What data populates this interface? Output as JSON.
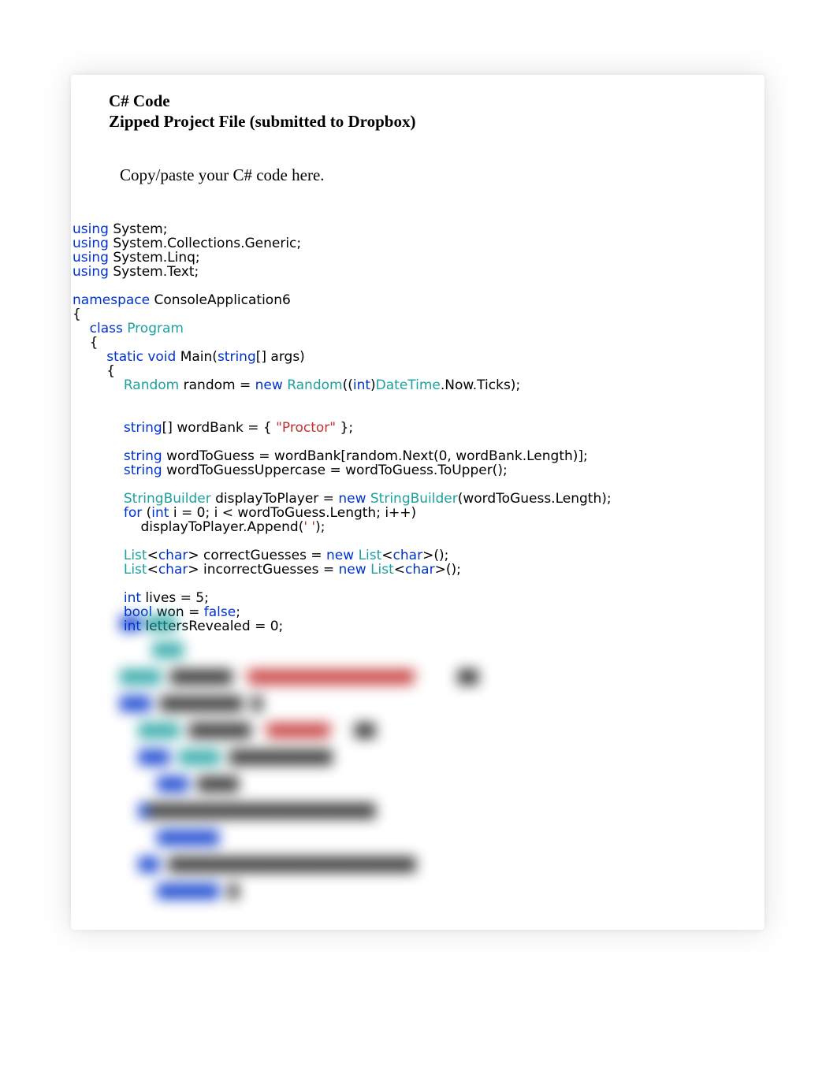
{
  "header": {
    "line1": "C# Code",
    "line2": "Zipped Project File (submitted to Dropbox)"
  },
  "instruction": "Copy/paste your C# code here.",
  "code": {
    "lines": [
      {
        "indent": 0,
        "tokens": [
          {
            "t": "using ",
            "c": "kw"
          },
          {
            "t": "System;",
            "c": "id"
          }
        ]
      },
      {
        "indent": 0,
        "tokens": [
          {
            "t": "using ",
            "c": "kw"
          },
          {
            "t": "System.Collections.Generic;",
            "c": "id"
          }
        ]
      },
      {
        "indent": 0,
        "tokens": [
          {
            "t": "using ",
            "c": "kw"
          },
          {
            "t": "System.Linq;",
            "c": "id"
          }
        ]
      },
      {
        "indent": 0,
        "tokens": [
          {
            "t": "using ",
            "c": "kw"
          },
          {
            "t": "System.Text;",
            "c": "id"
          }
        ]
      },
      {
        "indent": 0,
        "tokens": []
      },
      {
        "indent": 0,
        "tokens": [
          {
            "t": "namespace ",
            "c": "kw"
          },
          {
            "t": "ConsoleApplication6",
            "c": "id"
          }
        ]
      },
      {
        "indent": 0,
        "tokens": [
          {
            "t": "{",
            "c": "id"
          }
        ]
      },
      {
        "indent": 1,
        "tokens": [
          {
            "t": "class ",
            "c": "kw"
          },
          {
            "t": "Program",
            "c": "typ"
          }
        ]
      },
      {
        "indent": 1,
        "tokens": [
          {
            "t": "{",
            "c": "id"
          }
        ]
      },
      {
        "indent": 2,
        "tokens": [
          {
            "t": "static ",
            "c": "kw"
          },
          {
            "t": "void ",
            "c": "kw"
          },
          {
            "t": "Main(",
            "c": "id"
          },
          {
            "t": "string",
            "c": "kw"
          },
          {
            "t": "[] args)",
            "c": "id"
          }
        ]
      },
      {
        "indent": 2,
        "tokens": [
          {
            "t": "{",
            "c": "id"
          }
        ]
      },
      {
        "indent": 3,
        "tokens": [
          {
            "t": "Random",
            "c": "typ"
          },
          {
            "t": " random = ",
            "c": "id"
          },
          {
            "t": "new ",
            "c": "kw"
          },
          {
            "t": "Random",
            "c": "typ"
          },
          {
            "t": "((",
            "c": "id"
          },
          {
            "t": "int",
            "c": "kw"
          },
          {
            "t": ")",
            "c": "id"
          },
          {
            "t": "DateTime",
            "c": "typ"
          },
          {
            "t": ".Now.Ticks);",
            "c": "id"
          }
        ]
      },
      {
        "indent": 0,
        "tokens": []
      },
      {
        "indent": 0,
        "tokens": []
      },
      {
        "indent": 3,
        "tokens": [
          {
            "t": "string",
            "c": "kw"
          },
          {
            "t": "[] wordBank = { ",
            "c": "id"
          },
          {
            "t": "\"Proctor\"",
            "c": "str"
          },
          {
            "t": " };",
            "c": "id"
          }
        ]
      },
      {
        "indent": 0,
        "tokens": []
      },
      {
        "indent": 3,
        "tokens": [
          {
            "t": "string",
            "c": "kw"
          },
          {
            "t": " wordToGuess = wordBank[random.Next(0, wordBank.Length)];",
            "c": "id"
          }
        ]
      },
      {
        "indent": 3,
        "tokens": [
          {
            "t": "string",
            "c": "kw"
          },
          {
            "t": " wordToGuessUppercase = wordToGuess.ToUpper();",
            "c": "id"
          }
        ]
      },
      {
        "indent": 0,
        "tokens": []
      },
      {
        "indent": 3,
        "tokens": [
          {
            "t": "StringBuilder",
            "c": "typ"
          },
          {
            "t": " displayToPlayer = ",
            "c": "id"
          },
          {
            "t": "new ",
            "c": "kw"
          },
          {
            "t": "StringBuilder",
            "c": "typ"
          },
          {
            "t": "(wordToGuess.Length);",
            "c": "id"
          }
        ]
      },
      {
        "indent": 3,
        "tokens": [
          {
            "t": "for ",
            "c": "kw"
          },
          {
            "t": "(",
            "c": "id"
          },
          {
            "t": "int",
            "c": "kw"
          },
          {
            "t": " i = 0; i < wordToGuess.Length; i++)",
            "c": "id"
          }
        ]
      },
      {
        "indent": 4,
        "tokens": [
          {
            "t": "displayToPlayer.Append(",
            "c": "id"
          },
          {
            "t": "' '",
            "c": "str"
          },
          {
            "t": ");",
            "c": "id"
          }
        ]
      },
      {
        "indent": 0,
        "tokens": []
      },
      {
        "indent": 3,
        "tokens": [
          {
            "t": "List",
            "c": "typ"
          },
          {
            "t": "<",
            "c": "id"
          },
          {
            "t": "char",
            "c": "kw"
          },
          {
            "t": "> correctGuesses = ",
            "c": "id"
          },
          {
            "t": "new ",
            "c": "kw"
          },
          {
            "t": "List",
            "c": "typ"
          },
          {
            "t": "<",
            "c": "id"
          },
          {
            "t": "char",
            "c": "kw"
          },
          {
            "t": ">();",
            "c": "id"
          }
        ]
      },
      {
        "indent": 3,
        "tokens": [
          {
            "t": "List",
            "c": "typ"
          },
          {
            "t": "<",
            "c": "id"
          },
          {
            "t": "char",
            "c": "kw"
          },
          {
            "t": "> incorrectGuesses = ",
            "c": "id"
          },
          {
            "t": "new ",
            "c": "kw"
          },
          {
            "t": "List",
            "c": "typ"
          },
          {
            "t": "<",
            "c": "id"
          },
          {
            "t": "char",
            "c": "kw"
          },
          {
            "t": ">();",
            "c": "id"
          }
        ]
      },
      {
        "indent": 0,
        "tokens": []
      },
      {
        "indent": 3,
        "tokens": [
          {
            "t": "int",
            "c": "kw"
          },
          {
            "t": " lives = 5;",
            "c": "id"
          }
        ]
      },
      {
        "indent": 3,
        "tokens": [
          {
            "t": "bool",
            "c": "kw"
          },
          {
            "t": " won = ",
            "c": "id"
          },
          {
            "t": "false",
            "c": "kw"
          },
          {
            "t": ";",
            "c": "id"
          }
        ]
      },
      {
        "indent": 3,
        "tokens": [
          {
            "t": "int",
            "c": "kw"
          },
          {
            "t": " lettersRevealed = 0;",
            "c": "id"
          }
        ]
      }
    ]
  },
  "blurred": {
    "lines": [
      [
        {
          "t": "██ ",
          "c": "bb2"
        },
        {
          "t": "███",
          "c": "bb1"
        }
      ],
      [
        {
          "t": "       ███",
          "c": "bb1"
        }
      ],
      [
        {
          "t": "████",
          "c": "bb1"
        },
        {
          "t": "  ██████  ",
          "c": "bb4"
        },
        {
          "t": "\"████████████████\"",
          "c": "bb3"
        },
        {
          "t": "        ██",
          "c": "bb4"
        }
      ],
      [
        {
          "t": "███",
          "c": "bb2"
        },
        {
          "t": "  ████████  █",
          "c": "bb4"
        }
      ],
      [
        {
          "t": "    ████",
          "c": "bb1"
        },
        {
          "t": "  ██████  ",
          "c": "bb4"
        },
        {
          "t": "\"██████\"",
          "c": "bb3"
        },
        {
          "t": "    ██",
          "c": "bb4"
        }
      ],
      [
        {
          "t": "    ███",
          "c": "bb2"
        },
        {
          "t": "  ████",
          "c": "bb1"
        },
        {
          "t": "  ██████████",
          "c": "bb4"
        }
      ],
      [
        {
          "t": "        ███",
          "c": "bb2"
        },
        {
          "t": "  ████",
          "c": "bb4"
        }
      ],
      [
        {
          "t": "    █",
          "c": "bb2"
        },
        {
          "t": "██████████████████████",
          "c": "bb4"
        }
      ],
      [
        {
          "t": "        ██████",
          "c": "bb2"
        }
      ],
      [
        {
          "t": "    ██",
          "c": "bb2"
        },
        {
          "t": "  ████████████████████████",
          "c": "bb4"
        }
      ],
      [
        {
          "t": "        ██████",
          "c": "bb2"
        },
        {
          "t": "  █",
          "c": "bb4"
        }
      ]
    ]
  }
}
